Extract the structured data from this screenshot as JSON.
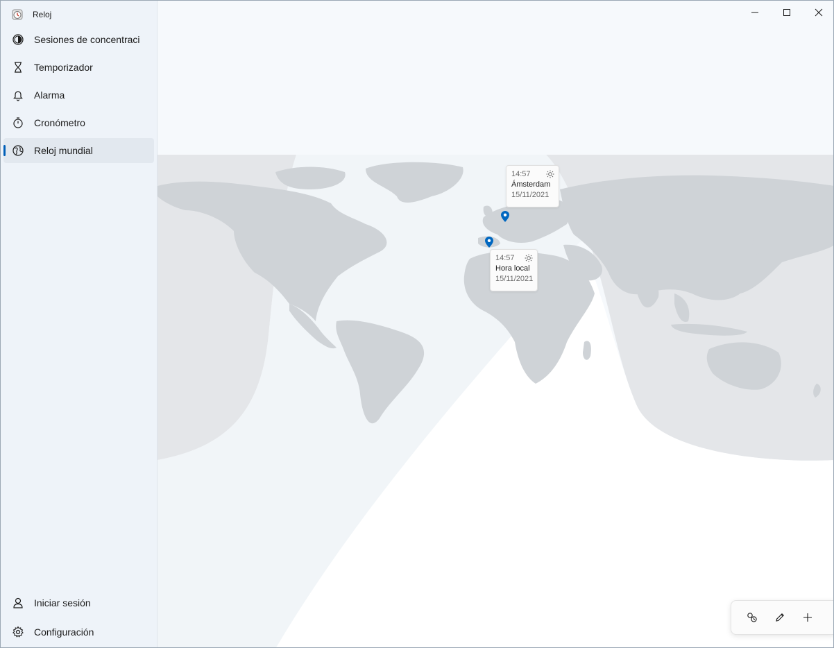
{
  "app": {
    "title": "Reloj",
    "icon": "clock-app-icon"
  },
  "nav": {
    "items": [
      {
        "label": "Sesiones de concentración",
        "icon": "focus-icon"
      },
      {
        "label": "Temporizador",
        "icon": "hourglass-icon"
      },
      {
        "label": "Alarma",
        "icon": "bell-icon"
      },
      {
        "label": "Cronómetro",
        "icon": "stopwatch-icon"
      },
      {
        "label": "Reloj mundial",
        "icon": "globe-icon",
        "selected": true
      }
    ],
    "bottom": [
      {
        "label": "Iniciar sesión",
        "icon": "person-icon"
      },
      {
        "label": "Configuración",
        "icon": "gear-icon"
      }
    ]
  },
  "window_controls": {
    "minimize": "minimize-icon",
    "maximize": "maximize-icon",
    "close": "close-icon"
  },
  "cities": [
    {
      "time": "14:57",
      "name": "Ámsterdam",
      "date": "15/11/2021"
    },
    {
      "time": "14:57",
      "name": "Hora local",
      "date": "15/11/2021"
    }
  ],
  "toolbar": {
    "compare": "compare-icon",
    "edit": "pencil-icon",
    "add": "plus-icon"
  },
  "colors": {
    "accent": "#005fb8",
    "pin": "#0067c0",
    "land": "#cfd3d7",
    "night": "#e4e6e9"
  }
}
